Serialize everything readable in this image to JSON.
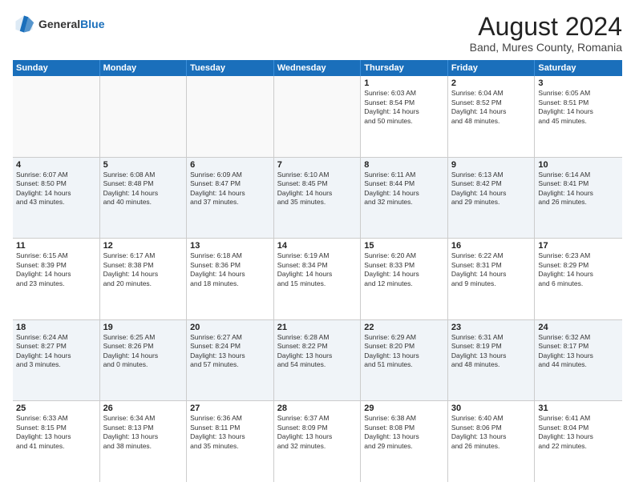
{
  "header": {
    "logo_general": "General",
    "logo_blue": "Blue",
    "title": "August 2024",
    "subtitle": "Band, Mures County, Romania"
  },
  "weekdays": [
    "Sunday",
    "Monday",
    "Tuesday",
    "Wednesday",
    "Thursday",
    "Friday",
    "Saturday"
  ],
  "weeks": [
    [
      {
        "day": "",
        "text": ""
      },
      {
        "day": "",
        "text": ""
      },
      {
        "day": "",
        "text": ""
      },
      {
        "day": "",
        "text": ""
      },
      {
        "day": "1",
        "text": "Sunrise: 6:03 AM\nSunset: 8:54 PM\nDaylight: 14 hours\nand 50 minutes."
      },
      {
        "day": "2",
        "text": "Sunrise: 6:04 AM\nSunset: 8:52 PM\nDaylight: 14 hours\nand 48 minutes."
      },
      {
        "day": "3",
        "text": "Sunrise: 6:05 AM\nSunset: 8:51 PM\nDaylight: 14 hours\nand 45 minutes."
      }
    ],
    [
      {
        "day": "4",
        "text": "Sunrise: 6:07 AM\nSunset: 8:50 PM\nDaylight: 14 hours\nand 43 minutes."
      },
      {
        "day": "5",
        "text": "Sunrise: 6:08 AM\nSunset: 8:48 PM\nDaylight: 14 hours\nand 40 minutes."
      },
      {
        "day": "6",
        "text": "Sunrise: 6:09 AM\nSunset: 8:47 PM\nDaylight: 14 hours\nand 37 minutes."
      },
      {
        "day": "7",
        "text": "Sunrise: 6:10 AM\nSunset: 8:45 PM\nDaylight: 14 hours\nand 35 minutes."
      },
      {
        "day": "8",
        "text": "Sunrise: 6:11 AM\nSunset: 8:44 PM\nDaylight: 14 hours\nand 32 minutes."
      },
      {
        "day": "9",
        "text": "Sunrise: 6:13 AM\nSunset: 8:42 PM\nDaylight: 14 hours\nand 29 minutes."
      },
      {
        "day": "10",
        "text": "Sunrise: 6:14 AM\nSunset: 8:41 PM\nDaylight: 14 hours\nand 26 minutes."
      }
    ],
    [
      {
        "day": "11",
        "text": "Sunrise: 6:15 AM\nSunset: 8:39 PM\nDaylight: 14 hours\nand 23 minutes."
      },
      {
        "day": "12",
        "text": "Sunrise: 6:17 AM\nSunset: 8:38 PM\nDaylight: 14 hours\nand 20 minutes."
      },
      {
        "day": "13",
        "text": "Sunrise: 6:18 AM\nSunset: 8:36 PM\nDaylight: 14 hours\nand 18 minutes."
      },
      {
        "day": "14",
        "text": "Sunrise: 6:19 AM\nSunset: 8:34 PM\nDaylight: 14 hours\nand 15 minutes."
      },
      {
        "day": "15",
        "text": "Sunrise: 6:20 AM\nSunset: 8:33 PM\nDaylight: 14 hours\nand 12 minutes."
      },
      {
        "day": "16",
        "text": "Sunrise: 6:22 AM\nSunset: 8:31 PM\nDaylight: 14 hours\nand 9 minutes."
      },
      {
        "day": "17",
        "text": "Sunrise: 6:23 AM\nSunset: 8:29 PM\nDaylight: 14 hours\nand 6 minutes."
      }
    ],
    [
      {
        "day": "18",
        "text": "Sunrise: 6:24 AM\nSunset: 8:27 PM\nDaylight: 14 hours\nand 3 minutes."
      },
      {
        "day": "19",
        "text": "Sunrise: 6:25 AM\nSunset: 8:26 PM\nDaylight: 14 hours\nand 0 minutes."
      },
      {
        "day": "20",
        "text": "Sunrise: 6:27 AM\nSunset: 8:24 PM\nDaylight: 13 hours\nand 57 minutes."
      },
      {
        "day": "21",
        "text": "Sunrise: 6:28 AM\nSunset: 8:22 PM\nDaylight: 13 hours\nand 54 minutes."
      },
      {
        "day": "22",
        "text": "Sunrise: 6:29 AM\nSunset: 8:20 PM\nDaylight: 13 hours\nand 51 minutes."
      },
      {
        "day": "23",
        "text": "Sunrise: 6:31 AM\nSunset: 8:19 PM\nDaylight: 13 hours\nand 48 minutes."
      },
      {
        "day": "24",
        "text": "Sunrise: 6:32 AM\nSunset: 8:17 PM\nDaylight: 13 hours\nand 44 minutes."
      }
    ],
    [
      {
        "day": "25",
        "text": "Sunrise: 6:33 AM\nSunset: 8:15 PM\nDaylight: 13 hours\nand 41 minutes."
      },
      {
        "day": "26",
        "text": "Sunrise: 6:34 AM\nSunset: 8:13 PM\nDaylight: 13 hours\nand 38 minutes."
      },
      {
        "day": "27",
        "text": "Sunrise: 6:36 AM\nSunset: 8:11 PM\nDaylight: 13 hours\nand 35 minutes."
      },
      {
        "day": "28",
        "text": "Sunrise: 6:37 AM\nSunset: 8:09 PM\nDaylight: 13 hours\nand 32 minutes."
      },
      {
        "day": "29",
        "text": "Sunrise: 6:38 AM\nSunset: 8:08 PM\nDaylight: 13 hours\nand 29 minutes."
      },
      {
        "day": "30",
        "text": "Sunrise: 6:40 AM\nSunset: 8:06 PM\nDaylight: 13 hours\nand 26 minutes."
      },
      {
        "day": "31",
        "text": "Sunrise: 6:41 AM\nSunset: 8:04 PM\nDaylight: 13 hours\nand 22 minutes."
      }
    ]
  ]
}
